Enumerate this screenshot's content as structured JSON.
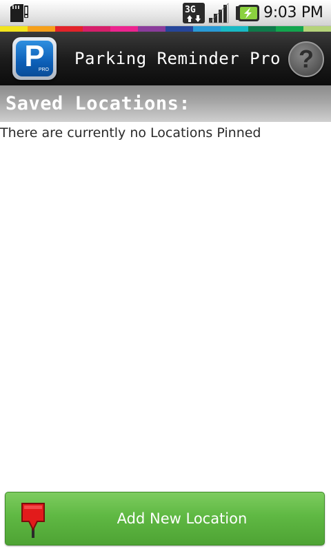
{
  "status_bar": {
    "time": "9:03 PM",
    "network_type": "3G",
    "icons": [
      "sd-card-warning-icon",
      "3g-data-icon",
      "signal-strength-icon",
      "battery-charging-icon"
    ]
  },
  "rainbow_colors": [
    "#f2e41d",
    "#f6a01a",
    "#e2232a",
    "#d61f6a",
    "#ec248f",
    "#8a3c9b",
    "#26469a",
    "#2a9ad6",
    "#19b9c4",
    "#0f7a4a",
    "#13a54e",
    "#b5d37a"
  ],
  "app": {
    "title": "Parking Reminder Pro",
    "icon_letter": "P",
    "icon_badge": "PRO",
    "help_symbol": "?"
  },
  "section": {
    "title": "Saved Locations:"
  },
  "locations": {
    "empty_message": "There are currently no Locations Pinned"
  },
  "add_button": {
    "label": "Add New Location",
    "icon": "red-map-pin-icon"
  },
  "colors": {
    "accent_green": "#5fb843",
    "title_bar": "#1c1c1c",
    "section_header": "#a6a6a6",
    "pin_red": "#e21b1b"
  }
}
